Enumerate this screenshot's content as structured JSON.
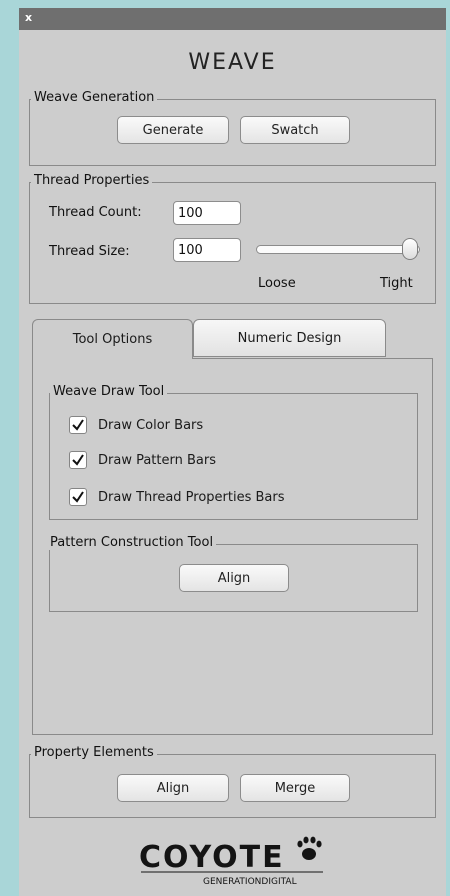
{
  "window": {
    "close_label": "x",
    "app_name": "WEAVE"
  },
  "weave_generation": {
    "title": "Weave Generation",
    "generate_label": "Generate",
    "swatch_label": "Swatch"
  },
  "thread_properties": {
    "title": "Thread Properties",
    "count_label": "Thread Count:",
    "count_value": "100",
    "size_label": "Thread Size:",
    "size_value": "100",
    "slider_min_label": "Loose",
    "slider_max_label": "Tight",
    "slider_level": 1.0
  },
  "tabs": [
    {
      "label": "Tool Options",
      "active": true
    },
    {
      "label": "Numeric Design",
      "active": false
    }
  ],
  "weave_draw_tool": {
    "title": "Weave Draw Tool",
    "options": [
      {
        "label": "Draw Color Bars",
        "checked": true
      },
      {
        "label": "Draw Pattern Bars",
        "checked": true
      },
      {
        "label": "Draw Thread Properties Bars",
        "checked": true
      }
    ]
  },
  "pattern_construction": {
    "title": "Pattern Construction Tool",
    "align_label": "Align"
  },
  "property_elements": {
    "title": "Property Elements",
    "align_label": "Align",
    "merge_label": "Merge"
  },
  "footer": {
    "brand": "COYOTE",
    "tagline": "GENERATIONDIGITAL"
  }
}
